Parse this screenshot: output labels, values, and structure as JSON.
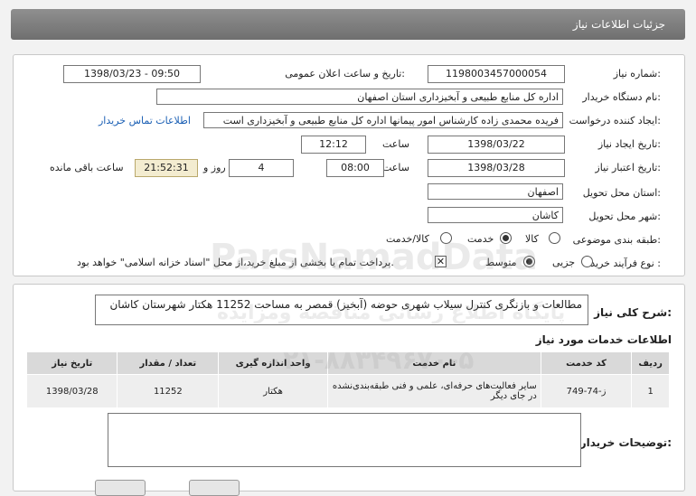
{
  "title": "جزئیات اطلاعات نیاز",
  "fields": {
    "need_number_label": "شماره نیاز:",
    "need_number": "1198003457000054",
    "announce_label": "تاریخ و ساعت اعلان عمومی:",
    "announce_value": "1398/03/23 - 09:50",
    "buyer_label": "نام دستگاه خریدار:",
    "buyer_value": "اداره کل منابع طبیعی و آبخیزداری استان اصفهان",
    "requester_label": "ایجاد کننده درخواست:",
    "requester_value": "فریده محمدی زاده کارشناس امور پیمانها اداره کل منابع طبیعی و آبخیزداری است",
    "contact_link": "اطلاعات تماس خریدار",
    "created_label": "تاریخ ایجاد نیاز:",
    "created_date": "1398/03/22",
    "time_label": "ساعت",
    "created_time": "12:12",
    "validity_label": "تاریخ اعتبار نیاز:",
    "validity_date": "1398/03/28",
    "validity_time": "08:00",
    "days_value": "4",
    "days_label": "روز و",
    "remaining_time": "21:52:31",
    "remaining_label": "ساعت باقی مانده",
    "province_label": "استان محل تحویل:",
    "province_value": "اصفهان",
    "city_label": "شهر محل تحویل:",
    "city_value": "کاشان",
    "category_label": "طبقه بندی موضوعی:",
    "category_options": [
      "کالا",
      "خدمت",
      "کالا/خدمت"
    ],
    "category_selected": "خدمت",
    "process_label": "نوع فرآیند خرید :",
    "process_options": [
      "جزیی",
      "متوسط"
    ],
    "process_selected": "متوسط",
    "payment_note": "پرداخت تمام یا بخشی از مبلغ خرید،از محل \"اسناد خزانه اسلامی\" خواهد بود."
  },
  "need": {
    "label": "شرح کلی نیاز:",
    "text": "مطالعات و بازنگری کنترل سیلاب شهری حوضه (آبخیز) قمصر به مساحت 11252 هکتار شهرستان کاشان"
  },
  "services": {
    "title": "اطلاعات خدمات مورد نیاز",
    "headers": [
      "ردیف",
      "کد خدمت",
      "نام خدمت",
      "واحد اندازه گیری",
      "تعداد / مقدار",
      "تاریخ نیاز"
    ],
    "rows": [
      [
        "1",
        "ز-74-749",
        "سایر فعالیت‌های حرفه‌ای، علمی و فنی طبقه‌بندی‌نشده در جای دیگر",
        "هکتار",
        "11252",
        "1398/03/28"
      ]
    ]
  },
  "buyer_notes_label": "توضیحات خریدار:",
  "watermark": {
    "line1": "ParsNamadData",
    "line2": "پایگاه اطلاع رسانی مناقصه ومزایده",
    "line3": "۰۲۱-۸۸۳۴۹۶۷۰-۵"
  }
}
